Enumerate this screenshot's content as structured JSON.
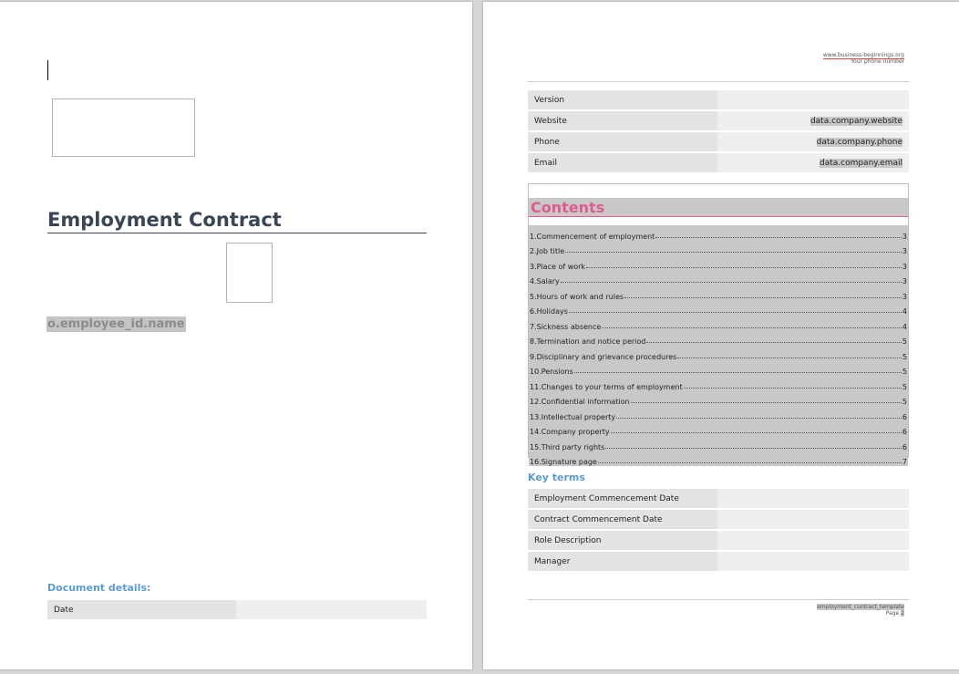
{
  "cover": {
    "title": "Employment Contract",
    "employee_field": "o.employee_id.name",
    "document_details_heading": "Document details:",
    "date_label": "Date",
    "date_value": ""
  },
  "header": {
    "website": "www.business-beginnings.org",
    "phone": "Your phone number"
  },
  "info_table": [
    {
      "label": "Version",
      "value": ""
    },
    {
      "label": "Website",
      "value": "data.company.website"
    },
    {
      "label": "Phone",
      "value": "data.company.phone"
    },
    {
      "label": "Email",
      "value": "data.company.email"
    }
  ],
  "contents": {
    "title": "Contents",
    "items": [
      {
        "label": "1.Commencement of employment",
        "page": "3"
      },
      {
        "label": "2.Job title",
        "page": "3"
      },
      {
        "label": "3.Place of work",
        "page": "3"
      },
      {
        "label": "4.Salary",
        "page": "3"
      },
      {
        "label": "5.Hours of work and rules",
        "page": "3"
      },
      {
        "label": "6.Holidays",
        "page": "4"
      },
      {
        "label": "7.Sickness absence",
        "page": "4"
      },
      {
        "label": "8.Termination and notice period",
        "page": "5"
      },
      {
        "label": "9.Disciplinary and grievance procedures",
        "page": "5"
      },
      {
        "label": "10.Pensions",
        "page": "5"
      },
      {
        "label": "11.Changes to your terms of employment",
        "page": "5"
      },
      {
        "label": "12.Confidential information",
        "page": "5"
      },
      {
        "label": "13.Intellectual property",
        "page": "6"
      },
      {
        "label": "14.Company property",
        "page": "6"
      },
      {
        "label": "15.Third party rights",
        "page": "6"
      },
      {
        "label": "16.Signature page",
        "page": "7"
      }
    ]
  },
  "key_terms": {
    "heading": "Key terms",
    "rows": [
      {
        "label": "Employment Commencement Date",
        "value": ""
      },
      {
        "label": "Contract Commencement Date",
        "value": ""
      },
      {
        "label": "Role Description",
        "value": ""
      },
      {
        "label": "Manager",
        "value": ""
      }
    ]
  },
  "footer": {
    "template_name": "employment_contract_template",
    "page_label": "Page",
    "page_num": "2"
  },
  "colors": {
    "title": "#3a4556",
    "heading_blue": "#5b9bd5",
    "contents_pink": "#e05b8f",
    "field_highlight": "#c8c8c8"
  }
}
